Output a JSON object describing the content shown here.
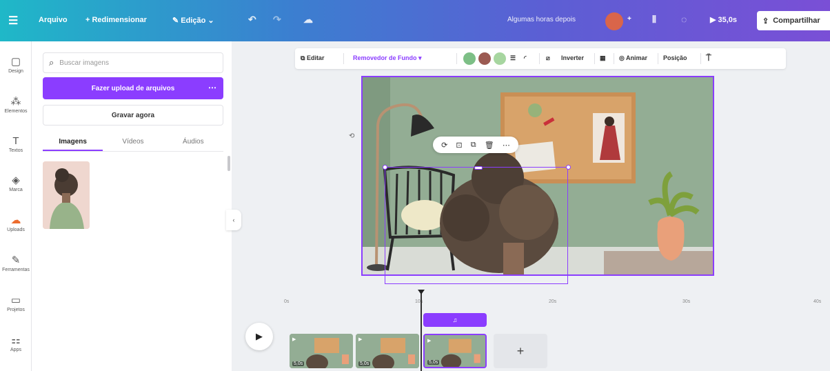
{
  "topbar": {
    "menu_icon": "menu-icon",
    "file": "Arquivo",
    "resize": "+ Redimensionar",
    "edit": "Edição",
    "saved_status": "Algumas horas depois",
    "play_label": "35,0s",
    "share": "Compartilhar"
  },
  "rail": [
    {
      "icon": "▢",
      "label": "Design"
    },
    {
      "icon": "⁂",
      "label": "Elementos"
    },
    {
      "icon": "T",
      "label": "Textos"
    },
    {
      "icon": "◈",
      "label": "Marca"
    },
    {
      "icon": "☁",
      "label": "Uploads"
    },
    {
      "icon": "✎",
      "label": "Ferramentas"
    },
    {
      "icon": "▭",
      "label": "Projetos"
    },
    {
      "icon": "⚏",
      "label": "Apps"
    }
  ],
  "panel": {
    "search_placeholder": "Buscar imagens",
    "upload": "Fazer upload de arquivos",
    "record": "Gravar agora",
    "tabs": [
      "Imagens",
      "Vídeos",
      "Áudios"
    ]
  },
  "context_toolbar": {
    "edit": "Editar",
    "bg_remover": "Removedor de Fundo",
    "flip": "Inverter",
    "animate": "Animar",
    "position": "Posição"
  },
  "colors": {
    "accent": "#8b3dff",
    "swatches": [
      "#7dbf86",
      "#9b5a52",
      "#a7d6a0"
    ]
  },
  "timeline": {
    "ruler": [
      "0s",
      "10s",
      "20s",
      "30s",
      "40s"
    ],
    "clips": [
      {
        "duration": "5,0s"
      },
      {
        "duration": "5,0s"
      },
      {
        "duration": "5,0s"
      }
    ],
    "add": "+"
  }
}
